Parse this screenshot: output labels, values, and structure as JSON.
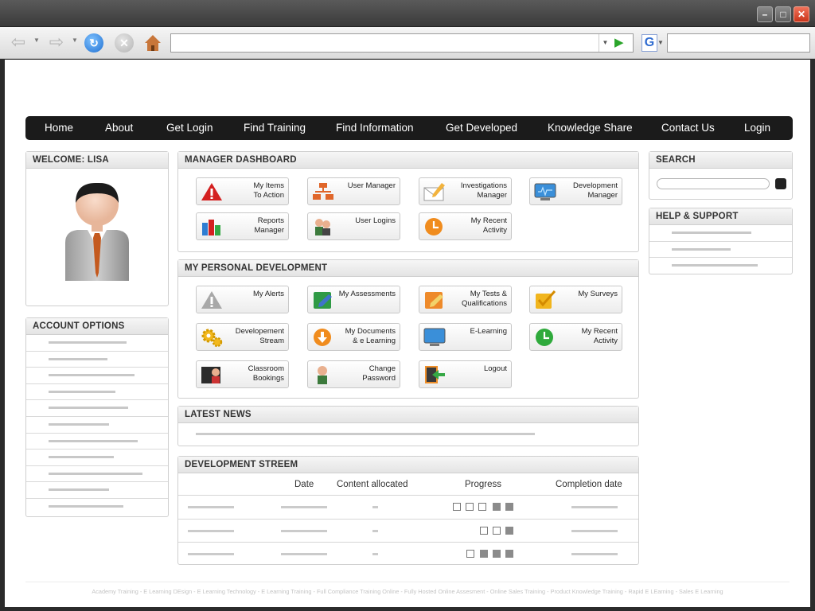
{
  "window": {
    "minimize_label": "–",
    "maximize_label": "□",
    "close_label": "✕"
  },
  "toolbar": {
    "back_icon": "back-arrow-icon",
    "forward_icon": "forward-arrow-icon",
    "refresh_icon": "refresh-icon",
    "stop_icon": "stop-icon",
    "home_icon": "home-icon",
    "url_value": "",
    "search_engine_label": "G",
    "search_value": ""
  },
  "nav": {
    "items": [
      "Home",
      "About",
      "Get Login",
      "Find Training",
      "Find Information",
      "Get Developed",
      "Knowledge Share",
      "Contact Us",
      "Login"
    ]
  },
  "welcome": {
    "title": "WELCOME: LISA"
  },
  "account": {
    "title": "ACCOUNT OPTIONS"
  },
  "search": {
    "title": "SEARCH",
    "value": ""
  },
  "help": {
    "title": "HELP & SUPPORT"
  },
  "manager": {
    "title": "MANAGER DASHBOARD",
    "tiles": [
      {
        "label": "My Items\nTo Action",
        "icon": "warning-icon"
      },
      {
        "label": "User Manager",
        "icon": "org-chart-icon"
      },
      {
        "label": "Investigations\nManager",
        "icon": "envelope-pencil-icon"
      },
      {
        "label": "Development\nManager",
        "icon": "monitor-icon"
      },
      {
        "label": "Reports\nManager",
        "icon": "bar-chart-icon"
      },
      {
        "label": "User Logins",
        "icon": "users-icon"
      },
      {
        "label": "My Recent\nActivity",
        "icon": "orange-clock-icon"
      }
    ]
  },
  "personal": {
    "title": "MY PERSONAL DEVELOPMENT",
    "tiles": [
      {
        "label": "My Alerts",
        "icon": "grey-warning-icon"
      },
      {
        "label": "My Assessments",
        "icon": "assessment-book-icon"
      },
      {
        "label": "My Tests &\nQualifications",
        "icon": "test-pencil-icon"
      },
      {
        "label": "My Surveys",
        "icon": "checkbox-icon"
      },
      {
        "label": "Developement\nStream",
        "icon": "gears-icon"
      },
      {
        "label": "My Documents\n& e Learning",
        "icon": "download-icon"
      },
      {
        "label": "E-Learning",
        "icon": "monitor-icon"
      },
      {
        "label": "My Recent\nActivity",
        "icon": "green-clock-icon"
      },
      {
        "label": "Classroom\nBookings",
        "icon": "classroom-icon"
      },
      {
        "label": "Change\nPassword",
        "icon": "user-icon"
      },
      {
        "label": "Logout",
        "icon": "logout-door-icon"
      }
    ]
  },
  "news": {
    "title": "LATEST NEWS"
  },
  "stream": {
    "title": "DEVELOPMENT STREEM",
    "columns": [
      "Date",
      "Content allocated",
      "Progress",
      "Completion date"
    ],
    "rows": [
      {
        "progress_total": 5,
        "progress_filled": 2
      },
      {
        "progress_total": 3,
        "progress_filled": 1
      },
      {
        "progress_total": 4,
        "progress_filled": 3
      }
    ]
  },
  "footer": {
    "text": "Academy Training - E Learning DEsign - E Learning Technology - E Learning Training - Full Compliance Training Online - Fully Hosted Online Assesment - Online Sales Training - Product Knowledge Training - Rapid E LEarning - Sales E Learning"
  },
  "colors": {
    "nav_bg": "#1b1b1b",
    "accent_red": "#d42020",
    "accent_orange": "#f08c1e",
    "accent_green": "#2faa3c"
  }
}
